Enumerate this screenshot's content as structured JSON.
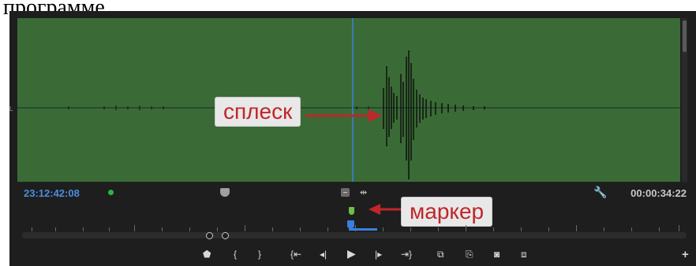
{
  "caption": {
    "text": "программе"
  },
  "monitor": {
    "channel_label": "L",
    "timecode_current": "23:12:42:08",
    "timecode_duration": "00:00:34:22",
    "background_color": "#3a6b36",
    "timecode_color": "#4a8de0"
  },
  "annotations": {
    "splash_label": "сплеск",
    "marker_label": "маркер",
    "label_color": "#c0262a"
  },
  "controls": {
    "add_marker": "⬟",
    "mark_in": "{",
    "mark_out": "}",
    "go_to_in": "{⇤",
    "step_back": "◂|",
    "play": "▶",
    "step_forward": "|▸",
    "go_to_out": "⇥}",
    "insert": "⧉",
    "overwrite": "⎘",
    "export_frame": "◙",
    "button_editor": "+"
  },
  "icons": {
    "wrench": "🔧",
    "fit": "⇹"
  }
}
